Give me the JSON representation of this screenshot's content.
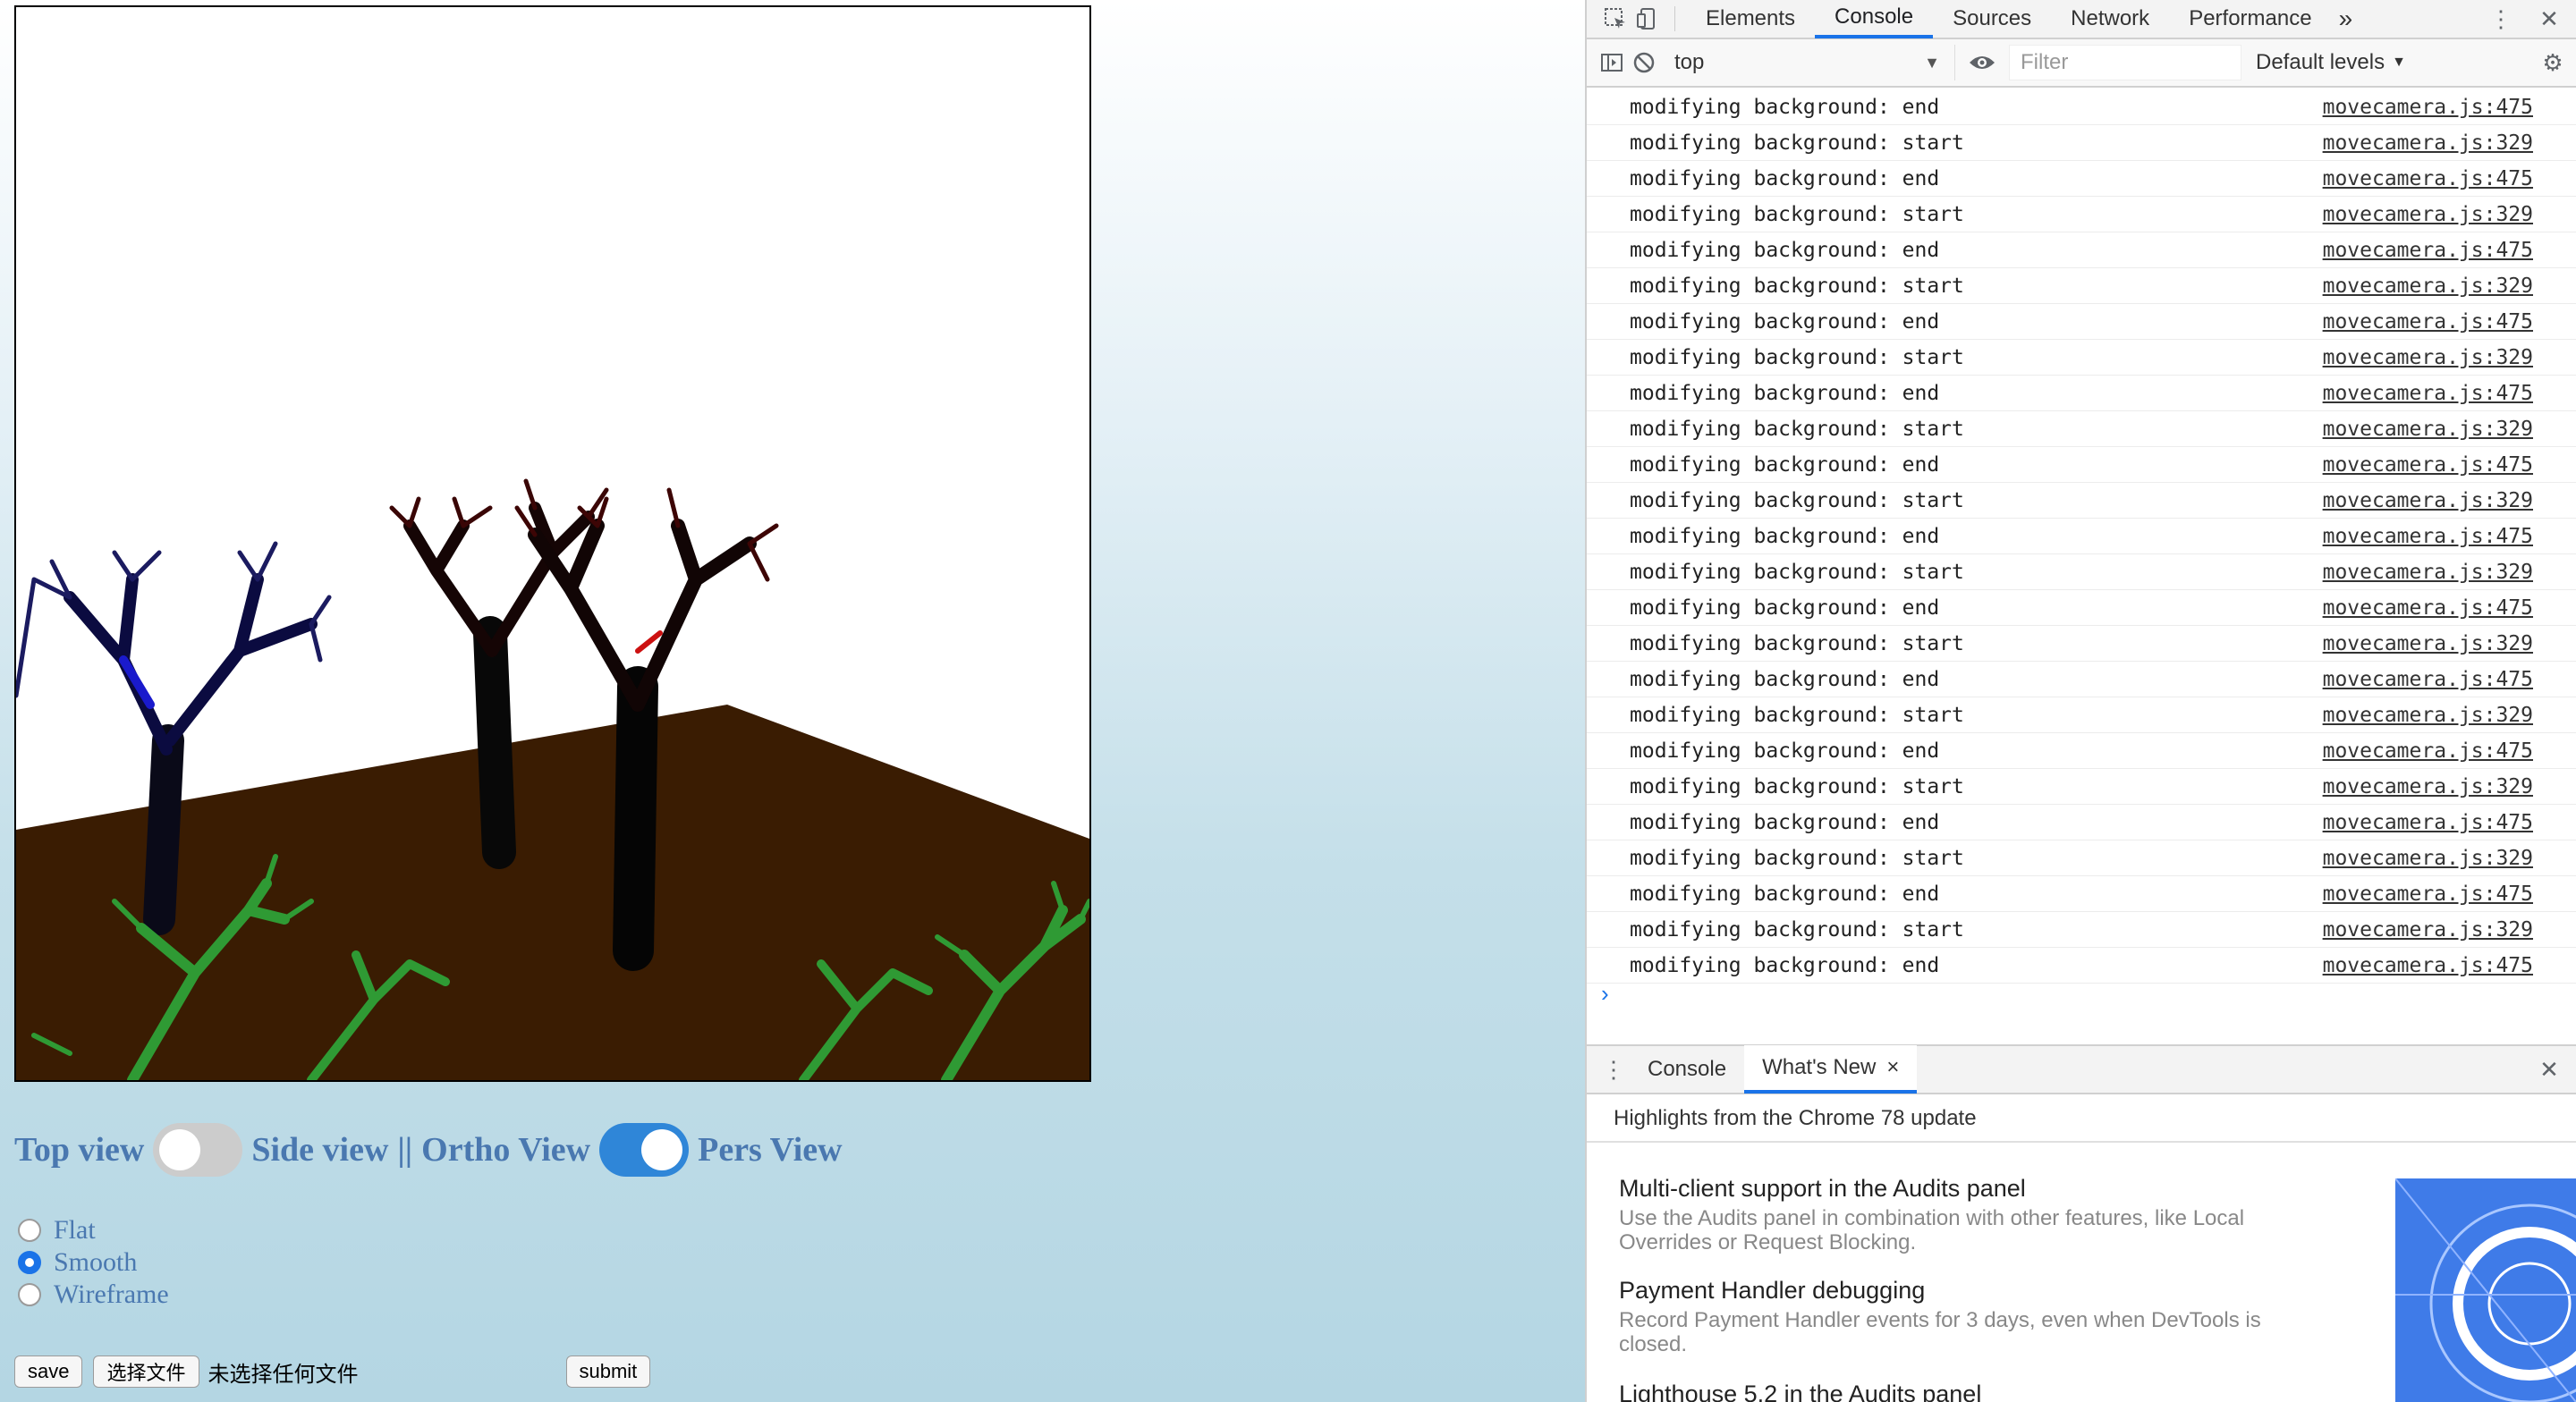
{
  "page": {
    "view_toggle": {
      "top_label": "Top view",
      "side_label": "Side view",
      "separator": "||",
      "ortho_label": "Ortho View",
      "pers_label": "Pers View"
    },
    "shading": {
      "options": [
        {
          "label": "Flat",
          "checked": false
        },
        {
          "label": "Smooth",
          "checked": true
        },
        {
          "label": "Wireframe",
          "checked": false
        }
      ]
    },
    "form": {
      "save_label": "save",
      "choose_file_label": "选择文件",
      "no_file_text": "未选择任何文件",
      "submit_label": "submit"
    },
    "colors": {
      "ground": "#3a1c02",
      "label_blue": "#4a78b0",
      "toggle_on": "#2f86d8"
    }
  },
  "devtools": {
    "tabs": [
      {
        "label": "Elements",
        "active": false
      },
      {
        "label": "Console",
        "active": true
      },
      {
        "label": "Sources",
        "active": false
      },
      {
        "label": "Network",
        "active": false
      },
      {
        "label": "Performance",
        "active": false
      }
    ],
    "more_tabs": "»",
    "context": "top",
    "filter_placeholder": "Filter",
    "levels": "Default levels",
    "log": [
      {
        "msg": "modifying background: end",
        "src": "movecamera.js:475"
      },
      {
        "msg": "modifying background: start",
        "src": "movecamera.js:329"
      },
      {
        "msg": "modifying background: end",
        "src": "movecamera.js:475"
      },
      {
        "msg": "modifying background: start",
        "src": "movecamera.js:329"
      },
      {
        "msg": "modifying background: end",
        "src": "movecamera.js:475"
      },
      {
        "msg": "modifying background: start",
        "src": "movecamera.js:329"
      },
      {
        "msg": "modifying background: end",
        "src": "movecamera.js:475"
      },
      {
        "msg": "modifying background: start",
        "src": "movecamera.js:329"
      },
      {
        "msg": "modifying background: end",
        "src": "movecamera.js:475"
      },
      {
        "msg": "modifying background: start",
        "src": "movecamera.js:329"
      },
      {
        "msg": "modifying background: end",
        "src": "movecamera.js:475"
      },
      {
        "msg": "modifying background: start",
        "src": "movecamera.js:329"
      },
      {
        "msg": "modifying background: end",
        "src": "movecamera.js:475"
      },
      {
        "msg": "modifying background: start",
        "src": "movecamera.js:329"
      },
      {
        "msg": "modifying background: end",
        "src": "movecamera.js:475"
      },
      {
        "msg": "modifying background: start",
        "src": "movecamera.js:329"
      },
      {
        "msg": "modifying background: end",
        "src": "movecamera.js:475"
      },
      {
        "msg": "modifying background: start",
        "src": "movecamera.js:329"
      },
      {
        "msg": "modifying background: end",
        "src": "movecamera.js:475"
      },
      {
        "msg": "modifying background: start",
        "src": "movecamera.js:329"
      },
      {
        "msg": "modifying background: end",
        "src": "movecamera.js:475"
      },
      {
        "msg": "modifying background: start",
        "src": "movecamera.js:329"
      },
      {
        "msg": "modifying background: end",
        "src": "movecamera.js:475"
      },
      {
        "msg": "modifying background: start",
        "src": "movecamera.js:329"
      },
      {
        "msg": "modifying background: end",
        "src": "movecamera.js:475"
      }
    ],
    "prompt_symbol": "›",
    "drawer": {
      "tabs": [
        {
          "label": "Console",
          "active": false
        },
        {
          "label": "What's New",
          "active": true
        }
      ],
      "close_tab_symbol": "×",
      "header": "Highlights from the Chrome 78 update",
      "items": [
        {
          "title": "Multi-client support in the Audits panel",
          "desc": "Use the Audits panel in combination with other features, like Local Overrides or Request Blocking."
        },
        {
          "title": "Payment Handler debugging",
          "desc": "Record Payment Handler events for 3 days, even when DevTools is closed."
        },
        {
          "title": "Lighthouse 5.2 in the Audits panel",
          "desc": ""
        }
      ]
    }
  }
}
